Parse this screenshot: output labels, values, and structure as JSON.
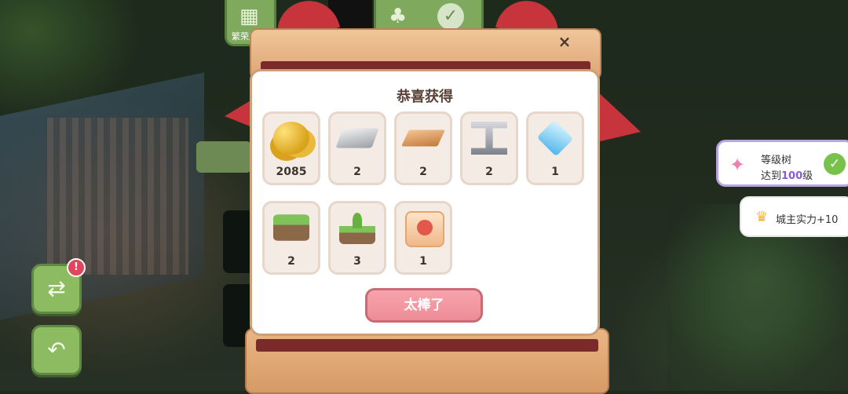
{
  "top_bar": {
    "prosperity_label": "繁荣度"
  },
  "dialog": {
    "title": "恭喜获得",
    "close_icon": "×",
    "confirm_label": "太棒了",
    "rewards": [
      {
        "icon": "gold-coins-icon",
        "count": "2085"
      },
      {
        "icon": "steel-bar-icon",
        "count": "2"
      },
      {
        "icon": "wood-plank-icon",
        "count": "2"
      },
      {
        "icon": "i-beam-icon",
        "count": "2"
      },
      {
        "icon": "ice-cube-icon",
        "count": "1"
      },
      {
        "icon": "grass-block-icon",
        "count": "2"
      },
      {
        "icon": "sprout-block-icon",
        "count": "3"
      },
      {
        "icon": "coupon-ticket-icon",
        "count": "1"
      }
    ]
  },
  "notifications": {
    "level_tree": {
      "line1": "等级树",
      "line2_prefix": "达到",
      "line2_value": "100",
      "line2_suffix": "级"
    },
    "city_power": {
      "text": "城主实力+10"
    }
  },
  "side": {
    "alert_badge": "!"
  },
  "colors": {
    "confirm_button": "#ee8c96",
    "panel_border": "#caa07a",
    "ribbon": "#c7343b",
    "accent_purple": "#8a5bd9"
  }
}
